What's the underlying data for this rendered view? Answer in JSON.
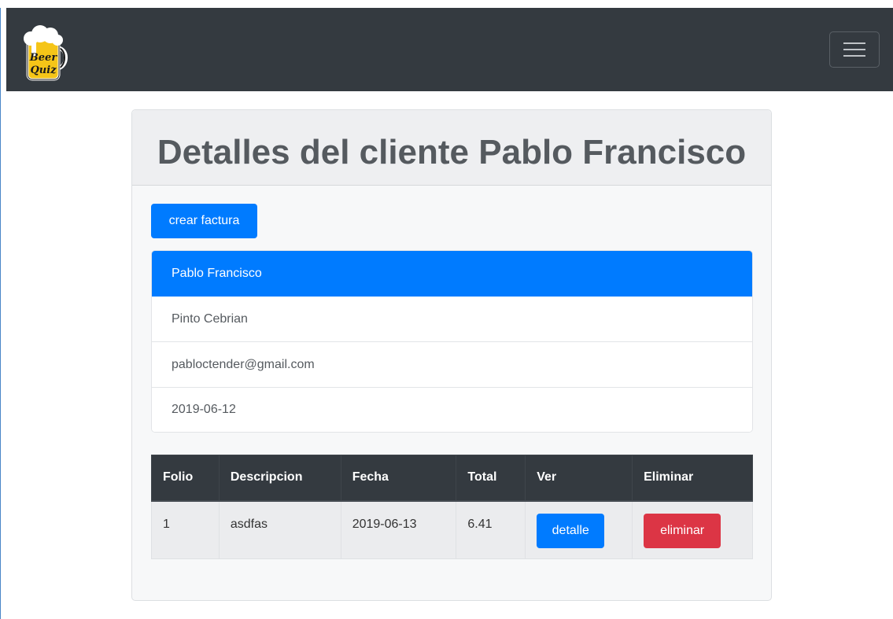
{
  "navbar": {
    "brand_icon": "beer-mug-logo-icon",
    "logo_text_line1": "Beer",
    "logo_text_line2": "Quiz",
    "toggler_icon": "hamburger-menu-icon"
  },
  "card": {
    "title": "Detalles del cliente Pablo Francisco",
    "create_button_label": "crear factura",
    "client_details": [
      "Pablo Francisco",
      "Pinto Cebrian",
      "pabloctender@gmail.com",
      "2019-06-12"
    ]
  },
  "table": {
    "headers": [
      "Folio",
      "Descripcion",
      "Fecha",
      "Total",
      "Ver",
      "Eliminar"
    ],
    "rows": [
      {
        "folio": "1",
        "descripcion": "asdfas",
        "fecha": "2019-06-13",
        "total": "6.41",
        "ver_label": "detalle",
        "eliminar_label": "eliminar"
      }
    ]
  },
  "colors": {
    "navbar": "#343a40",
    "primary": "#007bff",
    "danger": "#dc3545"
  }
}
